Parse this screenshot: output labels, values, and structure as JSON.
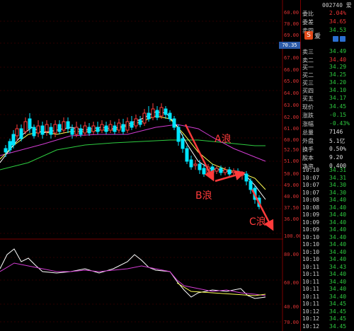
{
  "price_axis_labels": [
    "60.00",
    "70.00",
    "69.00",
    "68.00",
    "67.00",
    "66.00",
    "65.00",
    "64.00",
    "63.00",
    "62.00",
    "61.00",
    "60.00",
    "52.50",
    "51.00",
    "50.00",
    "49.00",
    "40.00",
    "37.50",
    "36.00",
    "100.00",
    "80.00",
    "60.00",
    "40.00",
    "70.00"
  ],
  "current_price_tag": "70.35",
  "top_code": "002740 爱",
  "quote": {
    "rows": [
      {
        "label": "委比",
        "value": "2.04%",
        "color": "#e33"
      },
      {
        "label": "委差",
        "value": "34.65",
        "color": "#e33"
      },
      {
        "label": "卖四",
        "value": "34.53",
        "color": "#2ecc40"
      },
      {
        "label": "卖三",
        "value": "34.49",
        "color": "#2ecc40"
      },
      {
        "label": "卖二",
        "value": "34.40",
        "color": "#e33"
      },
      {
        "label": "买一",
        "value": "34.29",
        "color": "#2ecc40"
      },
      {
        "label": "买二",
        "value": "34.25",
        "color": "#2ecc40"
      },
      {
        "label": "买三",
        "value": "34.20",
        "color": "#2ecc40"
      },
      {
        "label": "买四",
        "value": "34.10",
        "color": "#2ecc40"
      },
      {
        "label": "买五",
        "value": "34.17",
        "color": "#2ecc40"
      },
      {
        "label": "现价",
        "value": "34.45",
        "color": "#2ecc40"
      },
      {
        "label": "涨跌",
        "value": "-0.15",
        "color": "#2ecc40"
      },
      {
        "label": "涨幅",
        "value": "-0.43%",
        "color": "#2ecc40"
      },
      {
        "label": "总量",
        "value": "7146",
        "color": "#ddd"
      },
      {
        "label": "外盘",
        "value": "5.1亿",
        "color": "#ddd"
      },
      {
        "label": "换手",
        "value": "0.50%",
        "color": "#ddd"
      },
      {
        "label": "股本",
        "value": "9.20",
        "color": "#ddd"
      },
      {
        "label": "净资",
        "value": "0.400",
        "color": "#ddd"
      }
    ],
    "fav_badge": "S",
    "fav_label": "爱"
  },
  "ticks": [
    {
      "time": "10:10",
      "price": "34.31"
    },
    {
      "time": "10:07",
      "price": "34.31"
    },
    {
      "time": "10:07",
      "price": "34.30"
    },
    {
      "time": "10:07",
      "price": "34.30"
    },
    {
      "time": "10:08",
      "price": "34.40"
    },
    {
      "time": "10:08",
      "price": "34.40"
    },
    {
      "time": "10:09",
      "price": "34.40"
    },
    {
      "time": "10:09",
      "price": "34.40"
    },
    {
      "time": "10:09",
      "price": "34.40"
    },
    {
      "time": "10:10",
      "price": "34.40"
    },
    {
      "time": "10:10",
      "price": "34.40"
    },
    {
      "time": "10:10",
      "price": "34.40"
    },
    {
      "time": "10:10",
      "price": "34.40"
    },
    {
      "time": "10:11",
      "price": "34.43"
    },
    {
      "time": "10:11",
      "price": "34.40"
    },
    {
      "time": "10:11",
      "price": "34.40"
    },
    {
      "time": "10:11",
      "price": "34.40"
    },
    {
      "time": "10:11",
      "price": "34.40"
    },
    {
      "time": "10:11",
      "price": "34.45"
    },
    {
      "time": "10:12",
      "price": "34.45"
    },
    {
      "time": "10:12",
      "price": "34.45"
    },
    {
      "time": "10:12",
      "price": "34.45"
    }
  ],
  "annotations": {
    "wave_a": "A浪",
    "wave_b": "B浪",
    "wave_c": "C浪"
  },
  "colors": {
    "up": "#ff3b3b",
    "down": "#00e5ff",
    "ma_white": "#ffffff",
    "ma_yellow": "#ffff55",
    "ma_magenta": "#d23cd2",
    "ma_green": "#2ecc40",
    "annotation": "#ff3b3b"
  },
  "icons": [
    "favorite-badge-icon",
    "share-icon",
    "settings-icon"
  ]
}
